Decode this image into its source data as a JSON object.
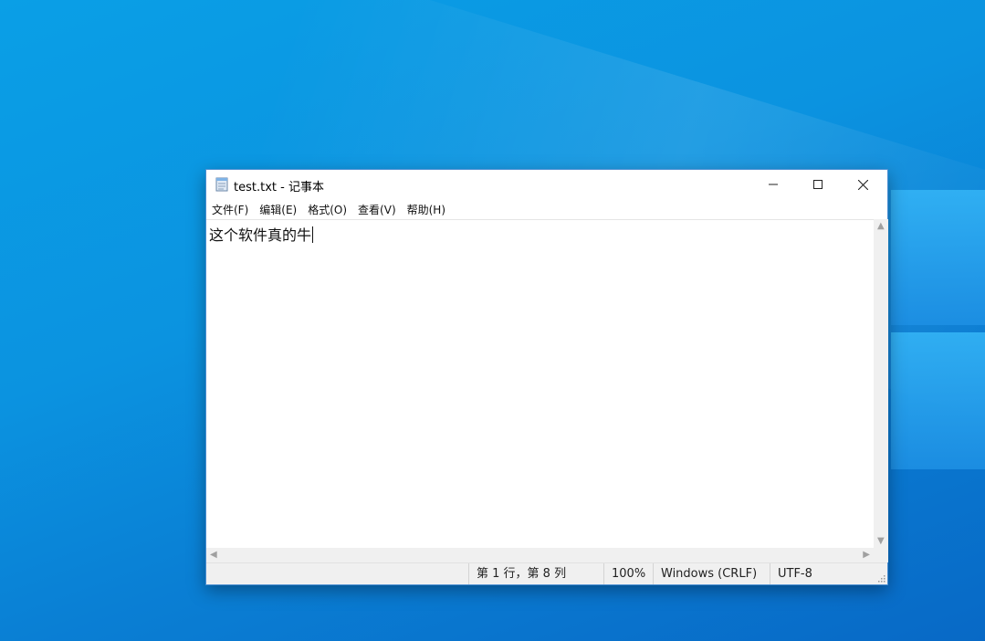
{
  "window": {
    "title": "test.txt - 记事本",
    "icon": "notepad-icon"
  },
  "titlebar_buttons": {
    "minimize": "minimize-icon",
    "maximize": "maximize-icon",
    "close": "close-icon"
  },
  "menu": [
    "文件(F)",
    "编辑(E)",
    "格式(O)",
    "查看(V)",
    "帮助(H)"
  ],
  "editor": {
    "text": "这个软件真的牛"
  },
  "statusbar": {
    "position": "第 1 行，第 8 列",
    "zoom": "100%",
    "line_ending": "Windows (CRLF)",
    "encoding": "UTF-8"
  },
  "colors": {
    "desktop": "#0b93e0",
    "window_border": "#4a8ed2",
    "statusbar_bg": "#f0f0f0"
  }
}
